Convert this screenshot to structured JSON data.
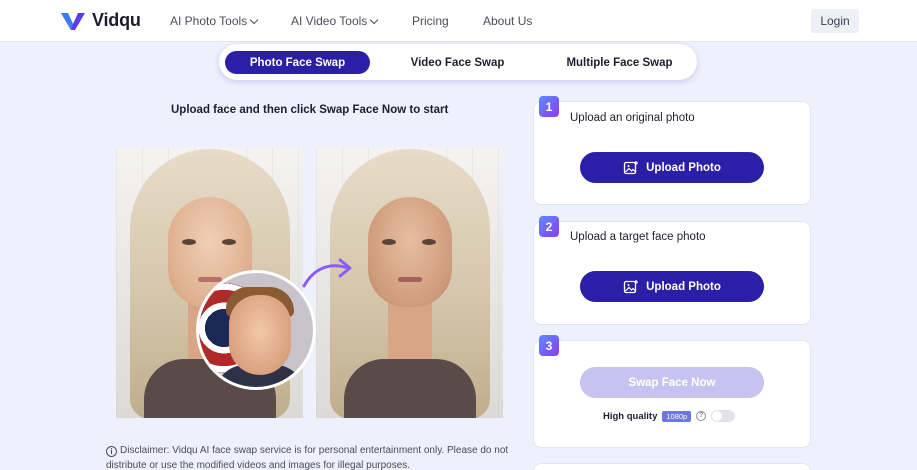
{
  "header": {
    "brand": "Vidqu",
    "nav": [
      {
        "label": "AI Photo Tools",
        "dropdown": true
      },
      {
        "label": "AI Video Tools",
        "dropdown": true
      },
      {
        "label": "Pricing",
        "dropdown": false
      },
      {
        "label": "About Us",
        "dropdown": false
      }
    ],
    "login_label": "Login"
  },
  "tabs": [
    {
      "label": "Photo Face Swap",
      "active": true
    },
    {
      "label": "Video Face Swap",
      "active": false
    },
    {
      "label": "Multiple Face Swap",
      "active": false
    }
  ],
  "instruction": "Upload face and then click Swap Face Now to start",
  "disclaimer": "Disclaimer: Vidqu AI face swap service is for personal entertainment only. Please do not distribute or use the modified videos and images for illegal purposes.",
  "steps": [
    {
      "number": "1",
      "label": "Upload an original photo",
      "button": "Upload Photo"
    },
    {
      "number": "2",
      "label": "Upload a target face photo",
      "button": "Upload Photo"
    },
    {
      "number": "3",
      "button": "Swap Face Now",
      "quality_label": "High quality",
      "quality_badge": "1080p",
      "quality_enabled": false
    }
  ],
  "colors": {
    "accent": "#2a1fa6",
    "disabled_button": "#c7c2f0",
    "background": "#eef0fb"
  }
}
